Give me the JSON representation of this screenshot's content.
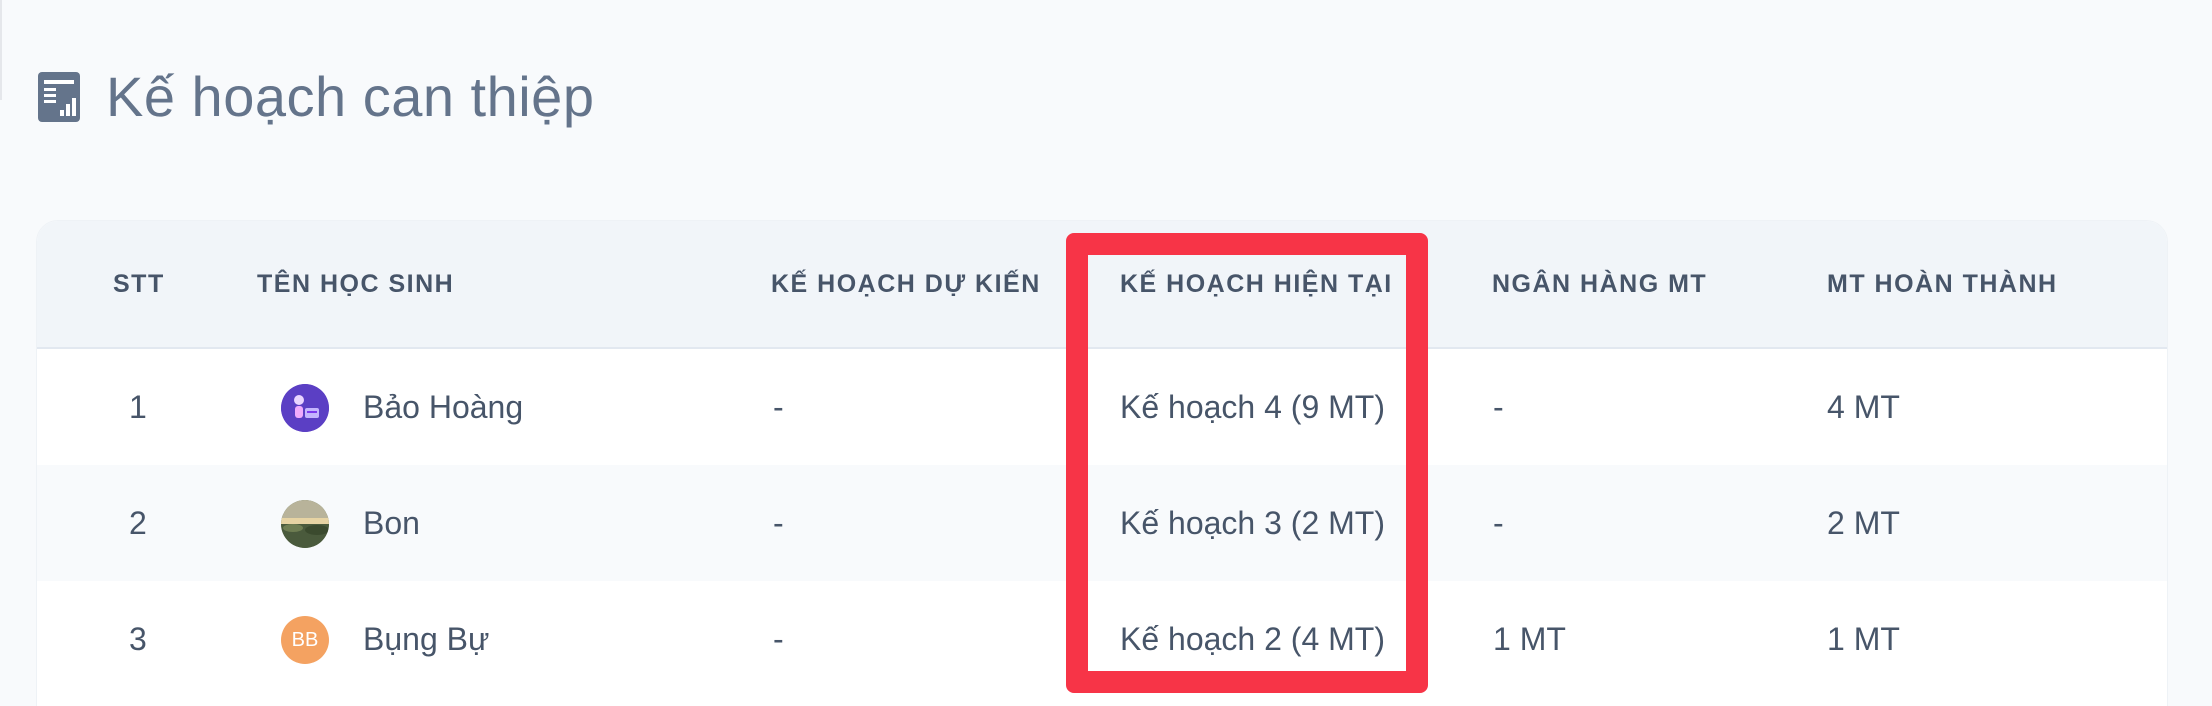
{
  "page": {
    "title": "Kế hoạch can thiệp",
    "title_icon": "report-chart-icon"
  },
  "table": {
    "columns": [
      {
        "key": "stt",
        "label": "STT"
      },
      {
        "key": "name",
        "label": "TÊN HỌC SINH"
      },
      {
        "key": "planned",
        "label": "KẾ HOẠCH DỰ KIẾN"
      },
      {
        "key": "current",
        "label": "KẾ HOẠCH HIỆN TẠI"
      },
      {
        "key": "bank",
        "label": "NGÂN HÀNG MT"
      },
      {
        "key": "done",
        "label": "MT HOÀN THÀNH"
      }
    ],
    "rows": [
      {
        "stt": "1",
        "avatar": {
          "type": "image",
          "icon": "cartoon-avatar",
          "color": "#5b3fc4"
        },
        "name": "Bảo Hoàng",
        "planned": "-",
        "current": "Kế hoạch 4 (9 MT)",
        "bank": "-",
        "done": "4 MT"
      },
      {
        "stt": "2",
        "avatar": {
          "type": "image",
          "icon": "landscape-photo-avatar",
          "color": "#6b7a5a"
        },
        "name": "Bon",
        "planned": "-",
        "current": "Kế hoạch 3 (2 MT)",
        "bank": "-",
        "done": "2 MT"
      },
      {
        "stt": "3",
        "avatar": {
          "type": "initials",
          "initials": "BB",
          "color": "#f4a261"
        },
        "name": "Bụng Bự",
        "planned": "-",
        "current": "Kế hoạch 2 (4 MT)",
        "bank": "1 MT",
        "done": "1 MT"
      }
    ]
  },
  "highlight": {
    "target_column": "current",
    "color": "#f73447"
  }
}
